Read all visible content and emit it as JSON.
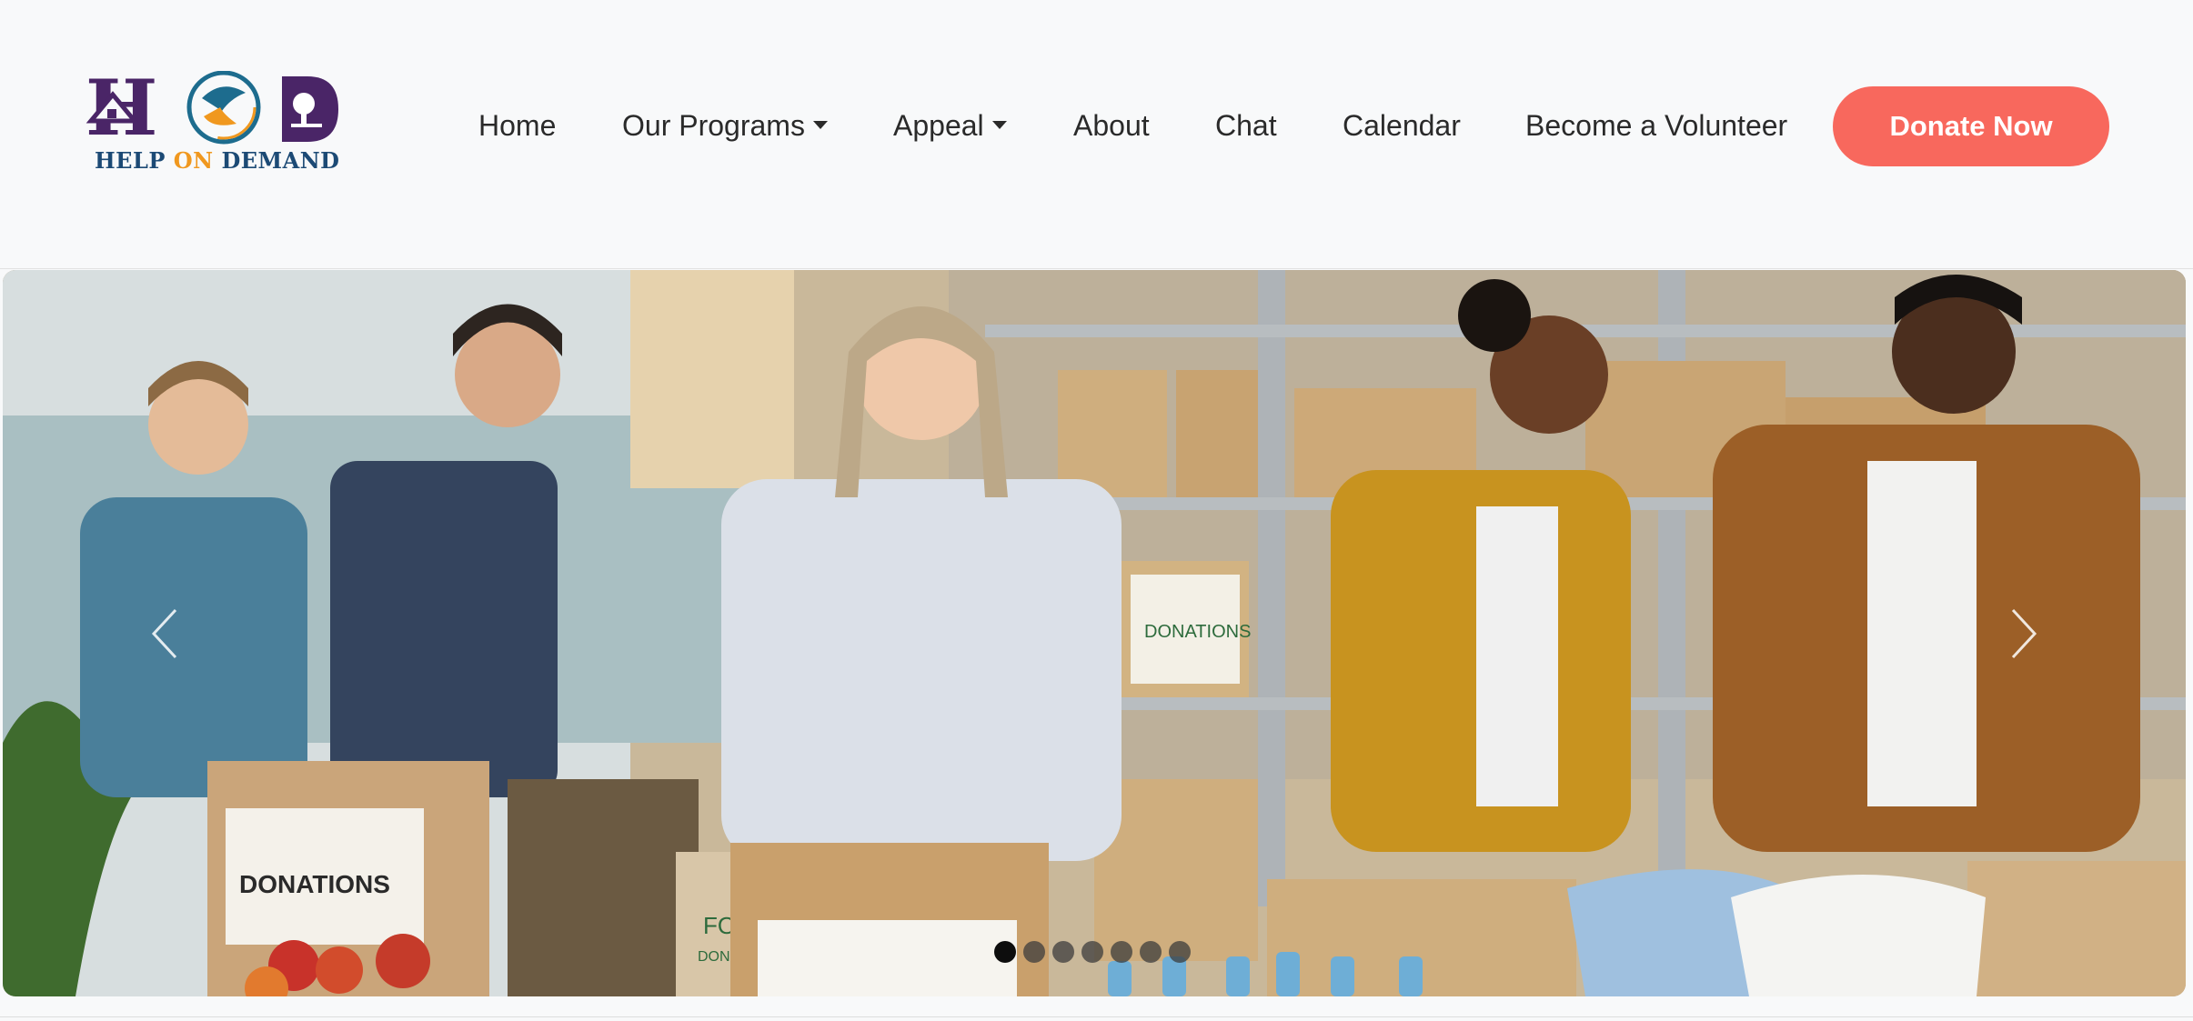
{
  "brand": {
    "logo_letters": [
      "H",
      "O",
      "D"
    ],
    "logo_text_parts": [
      "HELP ",
      "ON",
      " DEMAND"
    ],
    "colors": {
      "purple": "#4a2567",
      "orange": "#f0981f",
      "navy": "#1c4a75",
      "teal": "#1d6c8e"
    }
  },
  "nav": {
    "items": [
      {
        "label": "Home",
        "dropdown": false
      },
      {
        "label": "Our Programs",
        "dropdown": true
      },
      {
        "label": "Appeal",
        "dropdown": true
      },
      {
        "label": "About",
        "dropdown": false
      },
      {
        "label": "Chat",
        "dropdown": false
      },
      {
        "label": "Calendar",
        "dropdown": false
      },
      {
        "label": "Become a Volunteer",
        "dropdown": false
      }
    ],
    "cta_label": "Donate Now",
    "cta_color": "#f8685d"
  },
  "carousel": {
    "prev_icon": "chevron-left-icon",
    "next_icon": "chevron-right-icon",
    "slide_count": 7,
    "active_slide": 1,
    "box_labels": [
      "DONATIONS",
      "DONATIONS",
      "FO",
      "DON"
    ]
  }
}
